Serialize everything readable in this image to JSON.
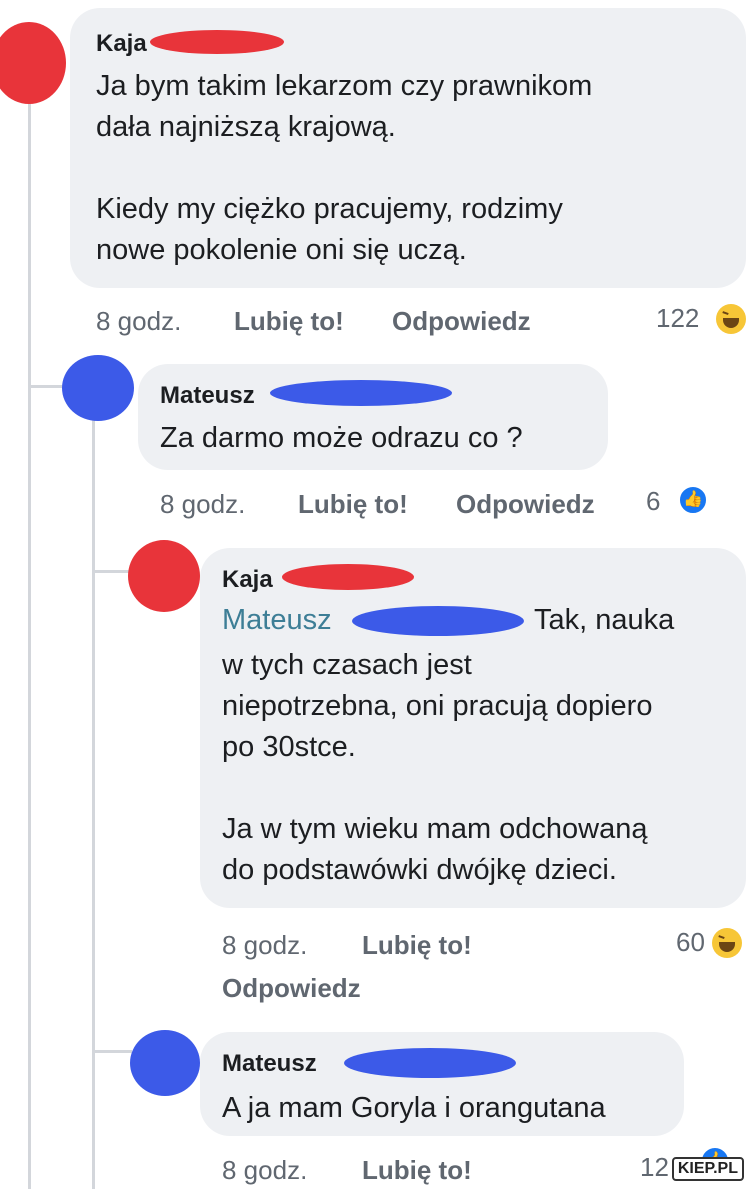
{
  "comments": [
    {
      "author": "Kaja",
      "text": "Ja bym takim lekarzom czy prawnikom\ndała najniższą krajową.\n\nKiedy my ciężko pracujemy, rodzimy\nnowe pokolenie oni się uczą.",
      "time": "8 godz.",
      "like": "Lubię to!",
      "reply": "Odpowiedz",
      "reactions": "122",
      "reaction_icon": "haha-icon"
    },
    {
      "author": "Mateusz",
      "text": "Za darmo może odrazu co ?",
      "time": "8 godz.",
      "like": "Lubię to!",
      "reply": "Odpowiedz",
      "reactions": "6",
      "reaction_icon": "like-icon"
    },
    {
      "author": "Kaja",
      "mention": "Mateusz",
      "text_after_mention": "Tak, nauka",
      "text": "w tych czasach jest\nniepotrzebna, oni pracują dopiero\npo 30stce.\n\nJa w tym wieku mam odchowaną\ndo podstawówki dwójkę dzieci.",
      "time": "8 godz.",
      "like": "Lubię to!",
      "reply": "Odpowiedz",
      "reactions": "60",
      "reaction_icon": "haha-icon"
    },
    {
      "author": "Mateusz",
      "text": "A ja mam Goryla i orangutana",
      "time": "8 godz.",
      "like": "Lubię to!",
      "reactions": "12",
      "reaction_icon": "like-icon"
    }
  ],
  "watermark": "KIEP.PL",
  "colors": {
    "bubble": "#eef0f3",
    "redact_red": "#e8343a",
    "redact_blue": "#3c5ae8",
    "mention": "#3d7e96"
  }
}
